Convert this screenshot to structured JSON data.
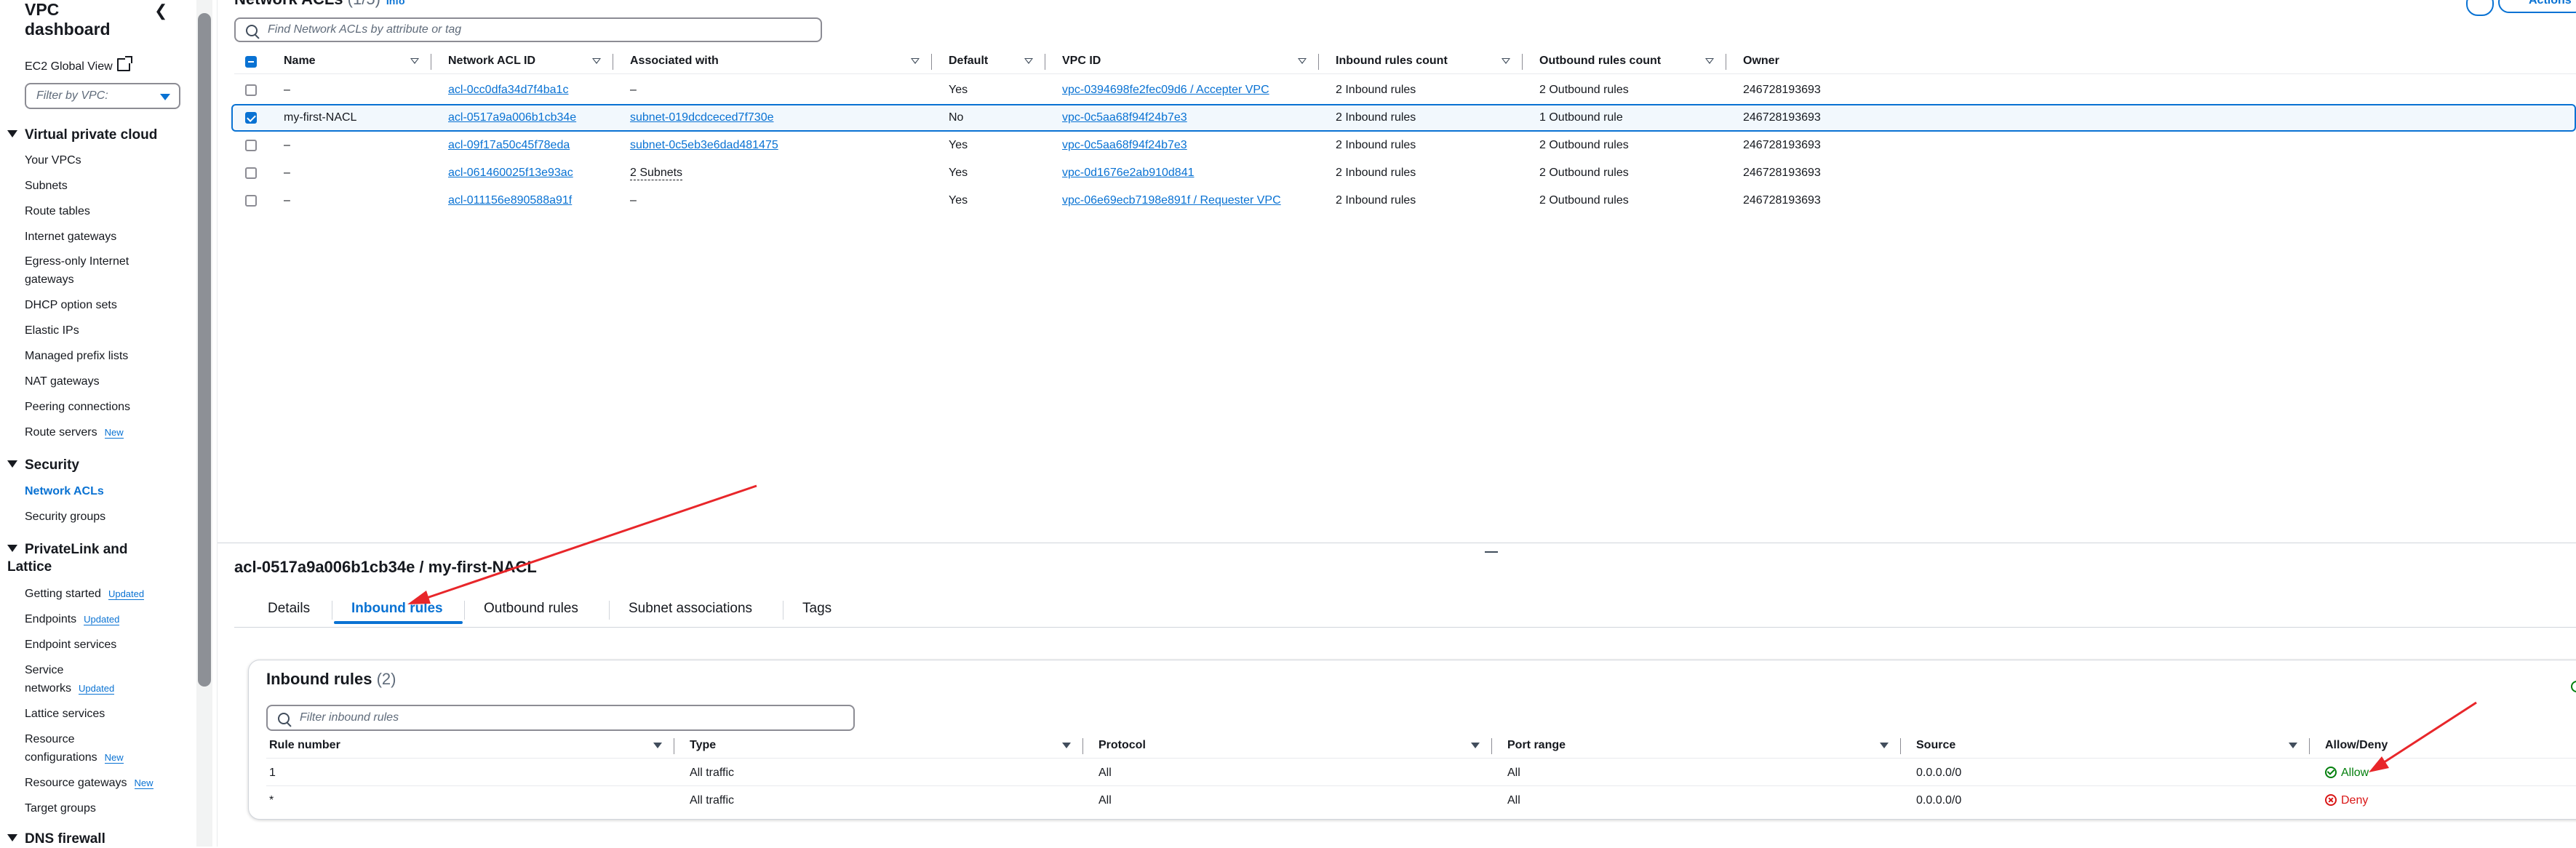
{
  "sidebar": {
    "title": "VPC dashboard",
    "global_view": "EC2 Global View",
    "filter_placeholder": "Filter by VPC:",
    "sections": {
      "vpc": "Virtual private cloud",
      "security": "Security",
      "privatelink": "PrivateLink and Lattice",
      "dns": "DNS firewall"
    },
    "vpc_items": [
      "Your VPCs",
      "Subnets",
      "Route tables",
      "Internet gateways",
      "Egress-only Internet",
      "gateways",
      "DHCP option sets",
      "Elastic IPs",
      "Managed prefix lists",
      "NAT gateways",
      "Peering connections",
      "Route servers"
    ],
    "security_items": [
      "Network ACLs",
      "Security groups"
    ],
    "privatelink_items": [
      "Getting started",
      "Endpoints",
      "Endpoint services",
      "Service",
      "networks",
      "Lattice services",
      "Resource",
      "configurations",
      "Resource gateways",
      "Target groups"
    ],
    "badges": {
      "new": "New",
      "updated": "Updated"
    }
  },
  "page": {
    "title": "Network ACLs",
    "count": "(1/5)",
    "info": "Info",
    "actions": "Actions",
    "search_placeholder": "Find Network ACLs by attribute or tag"
  },
  "table": {
    "columns": [
      "Name",
      "Network ACL ID",
      "Associated with",
      "Default",
      "VPC ID",
      "Inbound rules count",
      "Outbound rules count",
      "Owner"
    ],
    "rows": [
      {
        "name": "–",
        "acl_id": "acl-0cc0dfa34d7f4ba1c",
        "assoc": "–",
        "default": "Yes",
        "vpc": "vpc-0394698fe2fec09d6 / Accepter VPC",
        "inbound": "2 Inbound rules",
        "outbound": "2 Outbound rules",
        "owner": "246728193693",
        "checked": false
      },
      {
        "name": "my-first-NACL",
        "acl_id": "acl-0517a9a006b1cb34e",
        "assoc": "subnet-019dcdceced7f730e",
        "default": "No",
        "vpc": "vpc-0c5aa68f94f24b7e3",
        "inbound": "2 Inbound rules",
        "outbound": "1 Outbound rule",
        "owner": "246728193693",
        "checked": true
      },
      {
        "name": "–",
        "acl_id": "acl-09f17a50c45f78eda",
        "assoc": "subnet-0c5eb3e6dad481475",
        "default": "Yes",
        "vpc": "vpc-0c5aa68f94f24b7e3",
        "inbound": "2 Inbound rules",
        "outbound": "2 Outbound rules",
        "owner": "246728193693",
        "checked": false
      },
      {
        "name": "–",
        "acl_id": "acl-061460025f13e93ac",
        "assoc": "2 Subnets",
        "default": "Yes",
        "vpc": "vpc-0d1676e2ab910d841",
        "inbound": "2 Inbound rules",
        "outbound": "2 Outbound rules",
        "owner": "246728193693",
        "checked": false
      },
      {
        "name": "–",
        "acl_id": "acl-011156e890588a91f",
        "assoc": "–",
        "default": "Yes",
        "vpc": "vpc-06e69ecb7198e891f / Requester VPC",
        "inbound": "2 Inbound rules",
        "outbound": "2 Outbound rules",
        "owner": "246728193693",
        "checked": false
      }
    ]
  },
  "detail": {
    "title": "acl-0517a9a006b1cb34e / my-first-NACL",
    "tabs": [
      "Details",
      "Inbound rules",
      "Outbound rules",
      "Subnet associations",
      "Tags"
    ],
    "active_tab": "Inbound rules"
  },
  "inbound": {
    "title": "Inbound rules",
    "count": "(2)",
    "search_placeholder": "Filter inbound rules",
    "columns": [
      "Rule number",
      "Type",
      "Protocol",
      "Port range",
      "Source",
      "Allow/Deny"
    ],
    "rows": [
      {
        "rule": "1",
        "type": "All traffic",
        "protocol": "All",
        "port": "All",
        "source": "0.0.0.0/0",
        "action": "Allow"
      },
      {
        "rule": "*",
        "type": "All traffic",
        "protocol": "All",
        "port": "All",
        "source": "0.0.0.0/0",
        "action": "Deny"
      }
    ]
  },
  "colors": {
    "accent": "#0972d3",
    "allow": "#037f0c",
    "deny": "#d91515",
    "annotation": "#e8262a"
  }
}
